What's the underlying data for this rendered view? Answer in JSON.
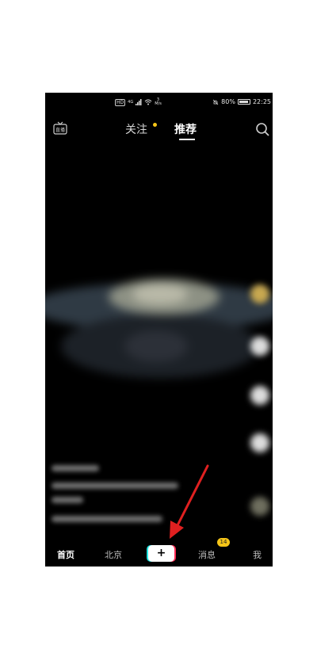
{
  "status_bar": {
    "hd": "HD",
    "network": "4G",
    "speed_value": "3",
    "speed_unit": "M/s",
    "battery": "80%",
    "time": "22:25"
  },
  "top_nav": {
    "tabs": [
      {
        "label": "关注",
        "active": false,
        "has_dot": true
      },
      {
        "label": "推荐",
        "active": true
      }
    ],
    "live_icon_label": "直播",
    "icons": [
      "live-tv-icon",
      "search-icon"
    ]
  },
  "bottom_nav": {
    "items": [
      {
        "label": "首页",
        "active": true
      },
      {
        "label": "北京"
      },
      {
        "label": "+"
      },
      {
        "label": "消息",
        "badge": "14"
      },
      {
        "label": "我"
      }
    ]
  },
  "colors": {
    "background": "#000000",
    "badge": "#f5c518",
    "accent_cyan": "#20e3e0",
    "accent_red": "#fe2c55",
    "annotation_arrow": "#e02020"
  }
}
